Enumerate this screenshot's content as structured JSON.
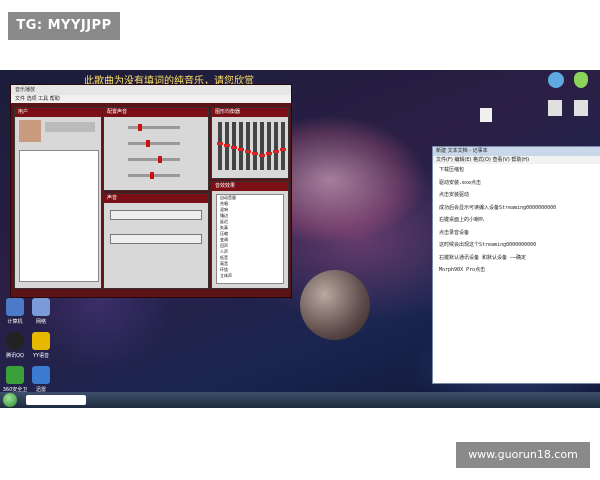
{
  "badge": "TG: MYYJJPP",
  "watermark": "www.guorun18.com",
  "caption": "此歌曲为没有填词的纯音乐，请您欣赏",
  "app": {
    "title": "音乐播放",
    "menu": "文件  选项  工具  帮助",
    "panel_user": "用户",
    "panel_eq_left": "配置声音",
    "panel_eq_right": "声音配置文件",
    "panel_eq": "图形均衡器",
    "panel_effects": "音效效果",
    "panel_sound": "声音",
    "effect_items": [
      "自动音量",
      "合唱",
      "混响",
      "镶边",
      "延迟",
      "失真",
      "压缩",
      "变调",
      "回声",
      "人声",
      "低音",
      "高音",
      "环绕",
      "立体声"
    ]
  },
  "notepad": {
    "title": "新建 文本文档 - 记事本",
    "menu": "文件(F)  编辑(E)  格式(O)  查看(V)  帮助(H)",
    "lines": [
      "下载压缩包",
      "驱动安装.exe点击",
      "点击安装驱动",
      "成功后会显示可读编入设备Streaming0000000000",
      "右键桌面上的小喇叭",
      "点击录音设备",
      "这时候会出现这个Streaming0000000000",
      "右键默认通讯设备 和默认设备 ——确定",
      "Morph90X Pro点击"
    ]
  },
  "desktop_icons": [
    "计算机",
    "网络",
    "腾讯QQ",
    "YY语音",
    "360安全卫士",
    "迅雷"
  ],
  "colors": {
    "accent": "#7a0f15",
    "caption": "#ffe066"
  }
}
